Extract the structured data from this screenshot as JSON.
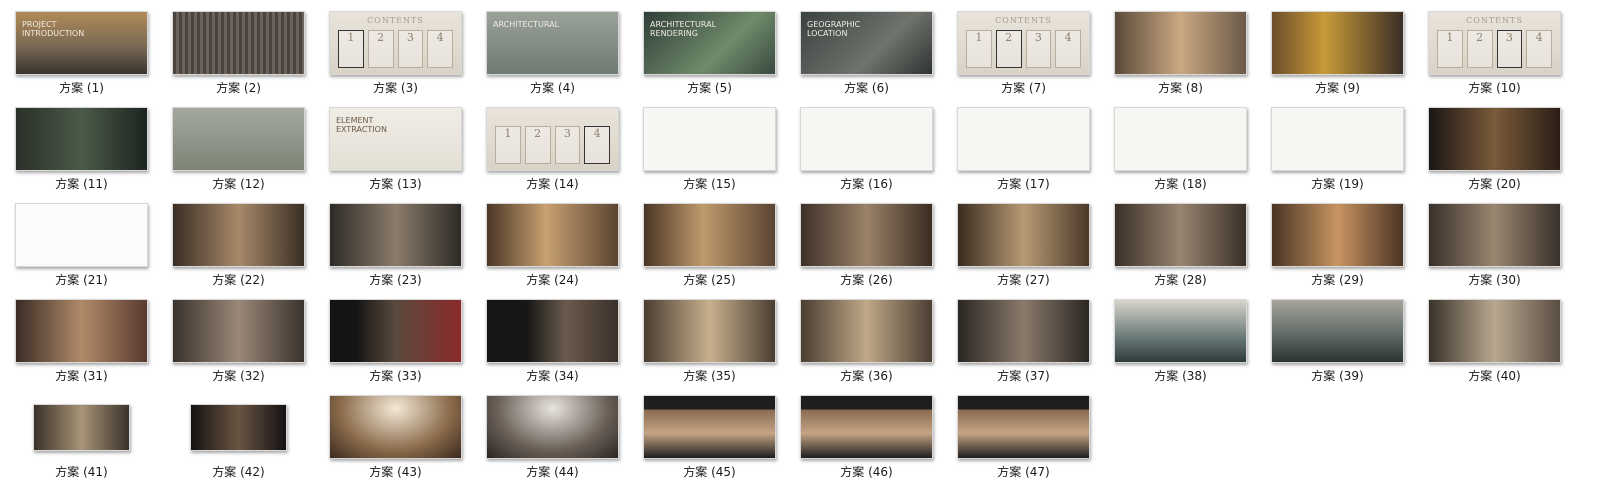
{
  "items": [
    {
      "label": "方案 (1)",
      "bg": "linear-gradient(180deg,#b08a55 0%,#7a6a55 55%,#3a3430 100%)",
      "overlay": "PROJECT INTRODUCTION"
    },
    {
      "label": "方案 (2)",
      "bg": "repeating-linear-gradient(90deg,#4a4440 0 3px,#6b625a 3px 6px)"
    },
    {
      "label": "方案 (3)",
      "bg": "linear-gradient(180deg,#e9e4db,#d9d2c6)",
      "cards": [
        "1",
        "2",
        "3",
        "4"
      ],
      "sel": 0,
      "header": "CONTENTS"
    },
    {
      "label": "方案 (4)",
      "bg": "linear-gradient(180deg,#9aa29a,#6f7a72)",
      "overlay": "ARCHITECTURAL"
    },
    {
      "label": "方案 (5)",
      "bg": "linear-gradient(135deg,#2f3e38,#6f8a6a 60%,#3a4a40)",
      "overlay": "ARCHITECTURAL RENDERING"
    },
    {
      "label": "方案 (6)",
      "bg": "linear-gradient(135deg,#3b4140,#6e736c 60%,#2f3432)",
      "overlay": "GEOGRAPHIC LOCATION"
    },
    {
      "label": "方案 (7)",
      "bg": "linear-gradient(180deg,#e9e4db,#d9d2c6)",
      "cards": [
        "1",
        "2",
        "3",
        "4"
      ],
      "sel": 1,
      "header": "CONTENTS"
    },
    {
      "label": "方案 (8)",
      "bg": "linear-gradient(90deg,#5a4a3a,#caa882 50%,#6a5a48)"
    },
    {
      "label": "方案 (9)",
      "bg": "linear-gradient(90deg,#6b4e2a,#c89a38 40%,#3a2e26)"
    },
    {
      "label": "方案 (10)",
      "bg": "linear-gradient(180deg,#e9e4db,#d9d2c6)",
      "cards": [
        "1",
        "2",
        "3",
        "4"
      ],
      "sel": 2,
      "header": "CONTENTS"
    },
    {
      "label": "方案 (11)",
      "bg": "linear-gradient(90deg,#2a3028,#4a5a48 50%,#1e2420)"
    },
    {
      "label": "方案 (12)",
      "bg": "linear-gradient(180deg,#a3a89c,#7d8577)"
    },
    {
      "label": "方案 (13)",
      "bg": "linear-gradient(180deg,#f0ede6,#e4dfd5)",
      "overlay": "ELEMENT EXTRACTION"
    },
    {
      "label": "方案 (14)",
      "bg": "linear-gradient(180deg,#e9e4db,#d9d2c6)",
      "cards": [
        "1",
        "2",
        "3",
        "4"
      ],
      "sel": 3
    },
    {
      "label": "方案 (15)",
      "bg": "#f7f6f3"
    },
    {
      "label": "方案 (16)",
      "bg": "#f7f6f3"
    },
    {
      "label": "方案 (17)",
      "bg": "#f7f6f3"
    },
    {
      "label": "方案 (18)",
      "bg": "#f7f6f3"
    },
    {
      "label": "方案 (19)",
      "bg": "#f7f6f3"
    },
    {
      "label": "方案 (20)",
      "bg": "linear-gradient(90deg,#1a1614,#7a5a3a 50%,#2a1e16)"
    },
    {
      "label": "方案 (21)",
      "bg": "#fbfbfa"
    },
    {
      "label": "方案 (22)",
      "bg": "linear-gradient(90deg,#3a2e24,#a8896a 50%,#3a2e24)"
    },
    {
      "label": "方案 (23)",
      "bg": "linear-gradient(90deg,#2e2a26,#8a7c6a 50%,#2e2a26)"
    },
    {
      "label": "方案 (24)",
      "bg": "linear-gradient(90deg,#4a3626,#c8a070 45%,#5a4432)"
    },
    {
      "label": "方案 (25)",
      "bg": "linear-gradient(90deg,#4a3626,#c09a6c 45%,#5a4432)"
    },
    {
      "label": "方案 (26)",
      "bg": "linear-gradient(90deg,#3e3028,#9a8268 50%,#3a2c22)"
    },
    {
      "label": "方案 (27)",
      "bg": "linear-gradient(90deg,#3a2c20,#b89a74 50%,#4a3828)"
    },
    {
      "label": "方案 (28)",
      "bg": "linear-gradient(90deg,#3a3028,#988470 50%,#3a3028)"
    },
    {
      "label": "方案 (29)",
      "bg": "linear-gradient(90deg,#4a3424,#c89462 50%,#4a3424)"
    },
    {
      "label": "方案 (30)",
      "bg": "linear-gradient(90deg,#38302a,#9a8670 50%,#38302a)"
    },
    {
      "label": "方案 (31)",
      "bg": "linear-gradient(90deg,#3a2c24,#b08a68 50%,#5a3a30)"
    },
    {
      "label": "方案 (32)",
      "bg": "linear-gradient(90deg,#3a322c,#9a8878 50%,#3a322c)"
    },
    {
      "label": "方案 (33)",
      "bg": "linear-gradient(90deg,#141414 0 20%,#5a4a3e 50%,#8a2a2a)"
    },
    {
      "label": "方案 (34)",
      "bg": "linear-gradient(90deg,#161616 0 30%,#6a5a4c 60%,#3a302a)"
    },
    {
      "label": "方案 (35)",
      "bg": "linear-gradient(90deg,#4a3e32,#c8b08e 50%,#4a3e32)"
    },
    {
      "label": "方案 (36)",
      "bg": "linear-gradient(90deg,#4a3e32,#c0a888 50%,#4a3e32)"
    },
    {
      "label": "方案 (37)",
      "bg": "linear-gradient(90deg,#2a2622,#8a7a6a 50%,#2a2622)"
    },
    {
      "label": "方案 (38)",
      "bg": "linear-gradient(180deg,#d8d4cc,#6a7a78 60%,#2e3a3a)"
    },
    {
      "label": "方案 (39)",
      "bg": "linear-gradient(180deg,#a8a49c,#5a6664 60%,#2a3232)"
    },
    {
      "label": "方案 (40)",
      "bg": "linear-gradient(90deg,#3a322a,#b8a890 50%,#5a4e42)"
    },
    {
      "label": "方案 (41)",
      "bg": "linear-gradient(90deg,#3a322a,#a89478 50%,#3a322a)"
    },
    {
      "label": "方案 (42)",
      "bg": "linear-gradient(90deg,#141212,#6a5442 50%,#141212)"
    },
    {
      "label": "方案 (43)",
      "bg": "radial-gradient(ellipse at 50% 20%,#f4ead8,#8a6a4a 60%,#3a2a20)"
    },
    {
      "label": "方案 (44)",
      "bg": "radial-gradient(ellipse at 50% 20%,#e8e4dc,#6a6058 60%,#2a2420)"
    },
    {
      "label": "方案 (45)",
      "bg": "linear-gradient(180deg,#1e1e1e 0 22%,#8a6a50 22%,#c4a484 60%,#1e1e1e)"
    },
    {
      "label": "方案 (46)",
      "bg": "linear-gradient(180deg,#1e1e1e 0 22%,#8a6a50 22%,#c4a484 60%,#1e1e1e)"
    },
    {
      "label": "方案 (47)",
      "bg": "linear-gradient(180deg,#1e1e1e 0 22%,#8a6a50 22%,#c4a484 60%,#1e1e1e)"
    }
  ]
}
